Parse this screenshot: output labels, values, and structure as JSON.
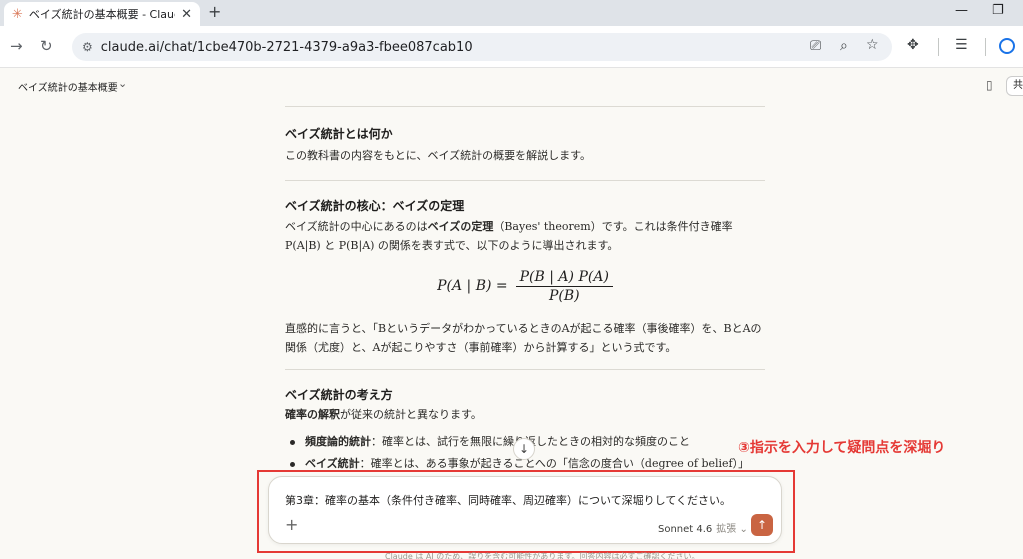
{
  "browser": {
    "tab_title": "ベイズ統計の基本概要 - Claude",
    "tab_close": "✕",
    "new_tab": "+",
    "url": "claude.ai/chat/1cbe470b-2721-4379-a9a3-fbee087cab10"
  },
  "conversation": {
    "title": "ベイズ統計の基本概要",
    "share_label": "共"
  },
  "article": {
    "h1": "ベイズ統計とは何か",
    "p1": "この教科書の内容をもとに、ベイズ統計の概要を解説します。",
    "h2": "ベイズ統計の核心：ベイズの定理",
    "p2_prefix": "ベイズ統計の中心にあるのは",
    "p2_bold": "ベイズの定理",
    "p2_rest": "（Bayes' theorem）です。これは条件付き確率 P(A|B) と P(B|A) の関係を表す式で、以下のように導出されます。",
    "formula_lhs": "P(A | B) =",
    "formula_num": "P(B | A) P(A)",
    "formula_den": "P(B)",
    "p3": "直感的に言うと、「BというデータがわかっているときのAが起こる確率（事後確率）を、BとAの関係（尤度）と、Aが起こりやすさ（事前確率）から計算する」という式です。",
    "h3": "ベイズ統計の考え方",
    "p4_bold": "確率の解釈",
    "p4_rest": "が従来の統計と異なります。",
    "b1_bold": "頻度論的統計",
    "b1_rest": "：確率とは、試行を無限に繰り返したときの相対的な頻度のこと",
    "b2_bold": "ベイズ統計",
    "b2_rest": "：確率とは、ある事象が起きることへの「信念の度合い（degree of belief）」"
  },
  "annotation": "③指示を入力して疑問点を深堀り",
  "composer": {
    "input_text": "第3章：確率の基本（条件付き確率、同時確率、周辺確率）について深堀りしてください。",
    "plus": "+",
    "model": "Sonnet 4.6",
    "mode": "拡張 ⌄",
    "send": "↑"
  },
  "disclaimer": "Claude は AI のため、誤りを含む可能性があります。回答内容は必ずご確認ください。"
}
